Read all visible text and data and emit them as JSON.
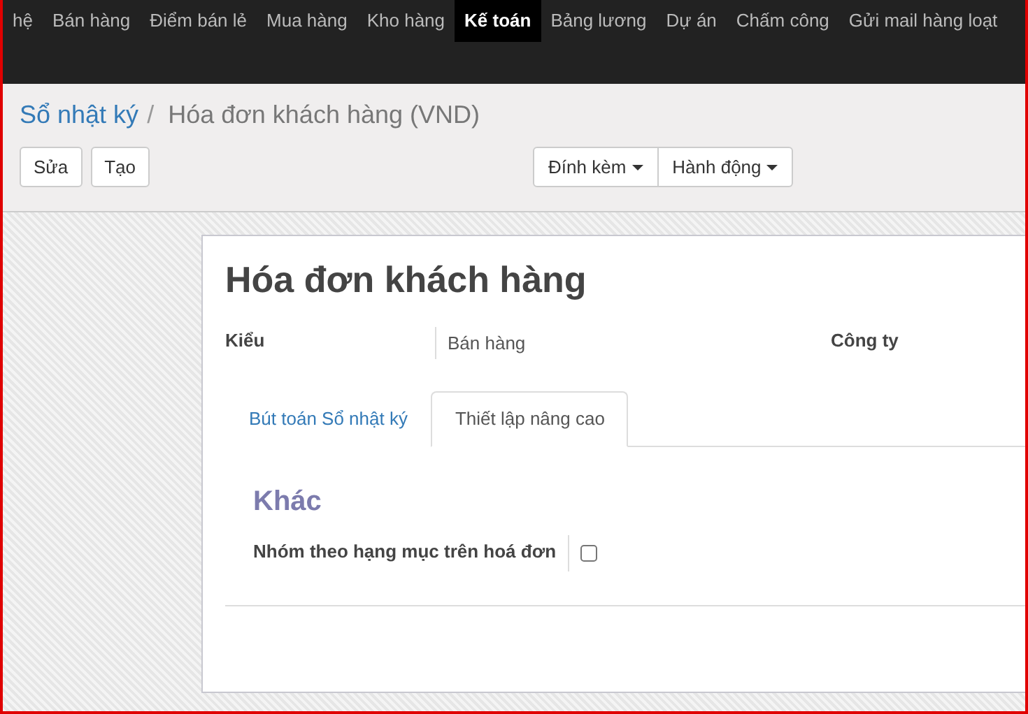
{
  "menu": [
    {
      "label": "hệ",
      "selected": false
    },
    {
      "label": "Bán hàng",
      "selected": false
    },
    {
      "label": "Điểm bán lẻ",
      "selected": false
    },
    {
      "label": "Mua hàng",
      "selected": false
    },
    {
      "label": "Kho hàng",
      "selected": false
    },
    {
      "label": "Kế toán",
      "selected": true
    },
    {
      "label": "Bảng lương",
      "selected": false
    },
    {
      "label": "Dự án",
      "selected": false
    },
    {
      "label": "Chấm công",
      "selected": false
    },
    {
      "label": "Gửi mail hàng loạt",
      "selected": false
    }
  ],
  "breadcrumb": {
    "parent": "Sổ nhật ký",
    "separator": "/",
    "current": "Hóa đơn khách hàng (VND)"
  },
  "buttons": [
    "Sửa",
    "Tạo"
  ],
  "dropdowns": [
    "Đính kèm",
    "Hành động"
  ],
  "sheet": {
    "title": "Hóa đơn khách hàng",
    "fields": [
      {
        "label": "Kiểu",
        "value": "Bán hàng"
      },
      {
        "label": "Công ty"
      }
    ],
    "tabs": [
      {
        "label": "Bút toán Sổ nhật ký",
        "selected": false
      },
      {
        "label": "Thiết lập nâng cao",
        "selected": true
      }
    ],
    "section": {
      "title": "Khác",
      "field": {
        "label": "Nhóm theo hạng mục trên hoá đơn",
        "checked": false
      }
    }
  }
}
